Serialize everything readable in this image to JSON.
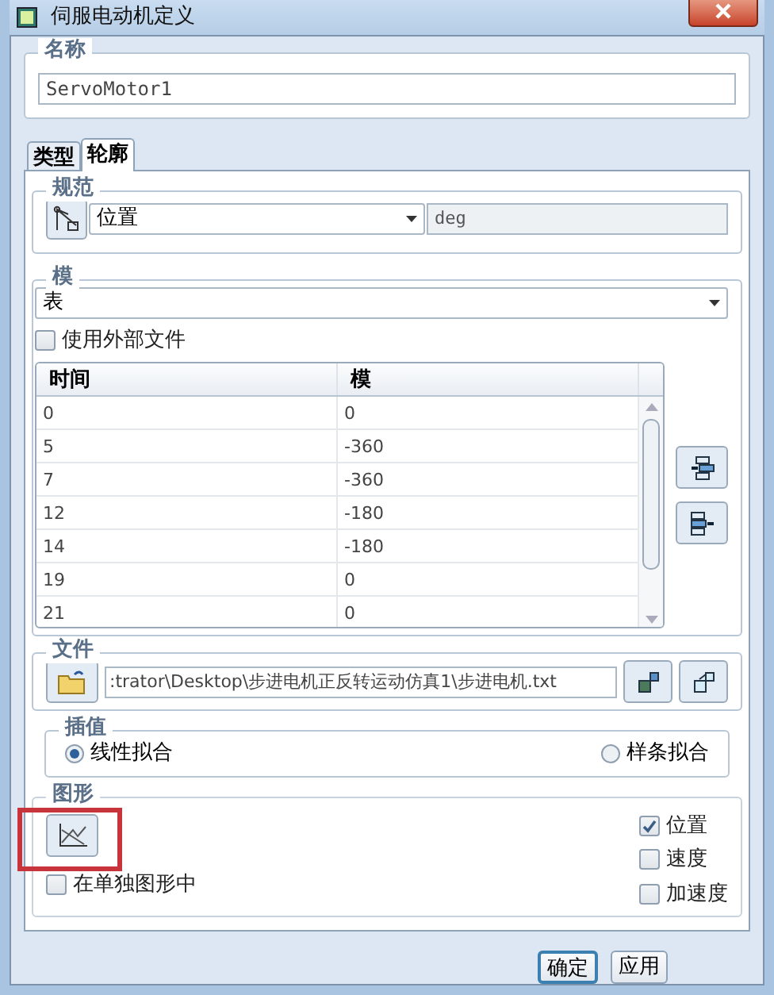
{
  "window": {
    "title": "伺服电动机定义"
  },
  "name_group": {
    "label": "名称",
    "value": "ServoMotor1"
  },
  "tabs": [
    {
      "label": "类型",
      "selected": false
    },
    {
      "label": "轮廓",
      "selected": true
    }
  ],
  "spec_group": {
    "label": "规范",
    "dropdown": "位置",
    "unit": "deg"
  },
  "module_group": {
    "label": "模",
    "dropdown": "表",
    "use_external_file": {
      "label": "使用外部文件",
      "checked": false
    },
    "table": {
      "columns": [
        "时间",
        "模"
      ],
      "rows": [
        [
          "0",
          "0"
        ],
        [
          "5",
          "-360"
        ],
        [
          "7",
          "-360"
        ],
        [
          "12",
          "-180"
        ],
        [
          "14",
          "-180"
        ],
        [
          "19",
          "0"
        ],
        [
          "21",
          "0"
        ]
      ]
    }
  },
  "file_group": {
    "label": "文件",
    "path": ":trator\\Desktop\\步进电机正反转运动仿真1\\步进电机.txt"
  },
  "interpolation_group": {
    "label": "插值",
    "options": [
      {
        "label": "线性拟合",
        "selected": true
      },
      {
        "label": "样条拟合",
        "selected": false
      }
    ]
  },
  "graph_group": {
    "label": "图形",
    "separate_graph": {
      "label": "在单独图形中",
      "checked": false
    },
    "plots": [
      {
        "label": "位置",
        "checked": true
      },
      {
        "label": "速度",
        "checked": false
      },
      {
        "label": "加速度",
        "checked": false
      }
    ]
  },
  "buttons": [
    "确定",
    "应用"
  ]
}
